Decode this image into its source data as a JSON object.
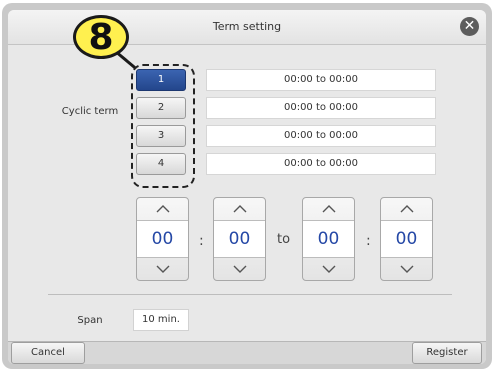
{
  "step_badge": "8",
  "dialog": {
    "title": "Term setting",
    "close_icon": "close-icon"
  },
  "cyclic_term": {
    "label": "Cyclic term",
    "items": [
      {
        "number": "1",
        "range": "00:00 to 00:00",
        "selected": true
      },
      {
        "number": "2",
        "range": "00:00 to 00:00",
        "selected": false
      },
      {
        "number": "3",
        "range": "00:00 to 00:00",
        "selected": false
      },
      {
        "number": "4",
        "range": "00:00 to 00:00",
        "selected": false
      }
    ]
  },
  "time_editor": {
    "start_hour": "00",
    "start_minute": "00",
    "separator": ":",
    "to_label": "to",
    "end_hour": "00",
    "end_minute": "00",
    "up_icon": "chevron-up-icon",
    "down_icon": "chevron-down-icon"
  },
  "span": {
    "label": "Span",
    "value": "10 min."
  },
  "footer": {
    "cancel_label": "Cancel",
    "register_label": "Register"
  },
  "colors": {
    "selected_button": "#2c529c",
    "time_value": "#2548a6",
    "badge": "#fff04f"
  }
}
